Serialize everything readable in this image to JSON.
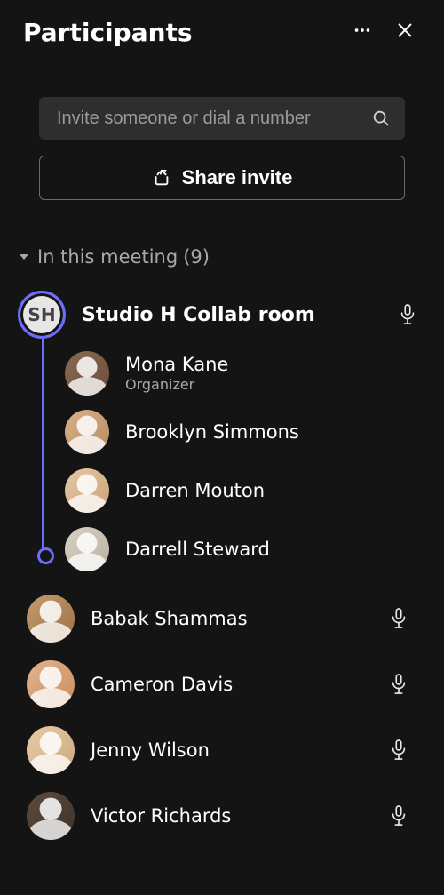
{
  "header": {
    "title": "Participants"
  },
  "invite": {
    "placeholder": "Invite someone or dial a number",
    "share_label": "Share invite"
  },
  "section": {
    "in_meeting_label": "In this meeting",
    "count": "(9)"
  },
  "room": {
    "initials": "SH",
    "name": "Studio H Collab room",
    "members": [
      {
        "name": "Mona Kane",
        "subtitle": "Organizer"
      },
      {
        "name": "Brooklyn Simmons"
      },
      {
        "name": "Darren Mouton"
      },
      {
        "name": "Darrell Steward"
      }
    ]
  },
  "participants": [
    {
      "name": "Babak Shammas"
    },
    {
      "name": "Cameron Davis"
    },
    {
      "name": "Jenny Wilson"
    },
    {
      "name": "Victor Richards"
    }
  ]
}
